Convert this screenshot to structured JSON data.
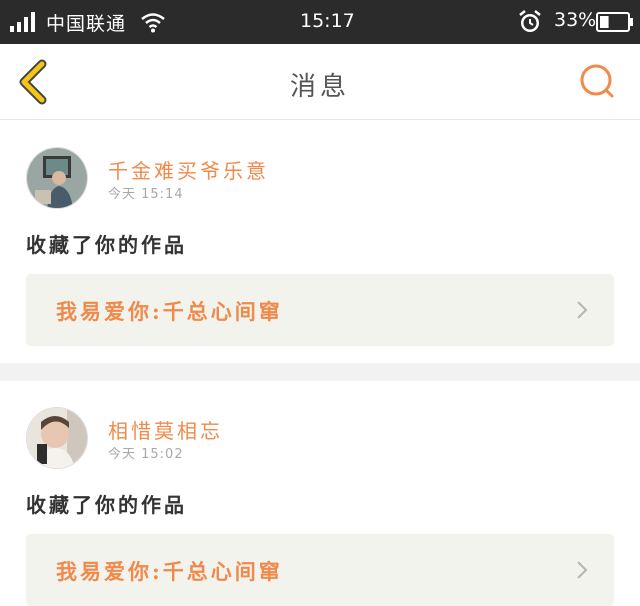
{
  "status_bar": {
    "carrier": "中国联通",
    "time": "15:17",
    "battery_percent": "33%",
    "battery_level": 0.33,
    "icons": [
      "signal-icon",
      "wifi-icon",
      "alarm-icon",
      "battery-icon"
    ]
  },
  "nav": {
    "title": "消息",
    "back_icon": "chevron-left-icon",
    "search_icon": "search-icon"
  },
  "colors": {
    "accent": "#f08a4b",
    "back_icon": "#f5c518",
    "text": "#333333",
    "muted": "#a8a8a8",
    "work_box_bg": "#f3f3ee",
    "status_bar_bg": "#2b2b2b"
  },
  "messages": [
    {
      "username": "千金难买爷乐意",
      "timestamp": "今天 15:14",
      "action": "收藏了你的作品",
      "work_title": "我易爱你:千总心间窜"
    },
    {
      "username": "相惜莫相忘",
      "timestamp": "今天 15:02",
      "action": "收藏了你的作品",
      "work_title": "我易爱你:千总心间窜"
    }
  ]
}
